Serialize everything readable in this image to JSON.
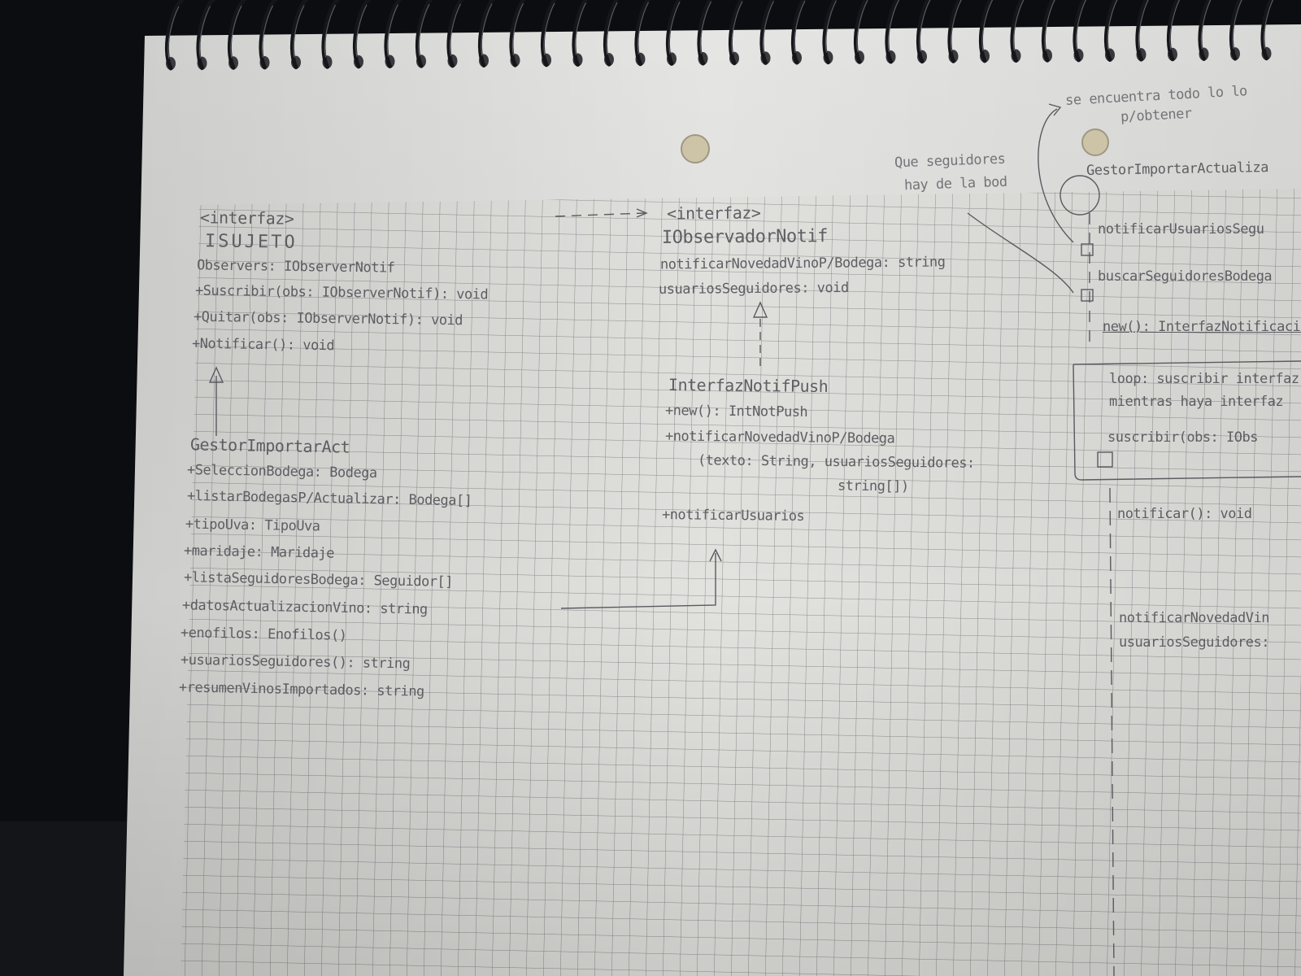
{
  "sheet": {
    "paper_color": "#e4e4e2",
    "grid_color": "#8c8c8e",
    "ink_color": "#54545a",
    "background_color": "#0c0d10"
  },
  "subject_interface": {
    "stereotype": "<interfaz>",
    "name": "ISUJETO",
    "lines": [
      "Observers: IObserverNotif",
      "+Suscribir(obs: IObserverNotif): void",
      "+Quitar(obs: IObserverNotif): void",
      "+Notificar(): void"
    ]
  },
  "gestor_class": {
    "name": "GestorImportarAct",
    "lines": [
      "+SeleccionBodega: Bodega",
      "+listarBodegasP/Actualizar: Bodega[]",
      "+tipoUva: TipoUva",
      "+maridaje: Maridaje",
      "+listaSeguidoresBodega: Seguidor[]",
      "+datosActualizacionVino: string",
      "+enofilos: Enofilos()",
      "+usuariosSeguidores(): string",
      "+resumenVinosImportados: string"
    ]
  },
  "observer_interface": {
    "stereotype": "<interfaz>",
    "name": "IObservadorNotif",
    "lines": [
      "notificarNovedadVinoP/Bodega: string",
      "usuariosSeguidores: void"
    ]
  },
  "push_class": {
    "name": "InterfazNotifPush",
    "lines": [
      "+new(): IntNotPush",
      "+notificarNovedadVinoP/Bodega",
      "(texto: String, usuariosSeguidores:",
      "string[])",
      "+notificarUsuarios"
    ]
  },
  "sequence_notes": {
    "note_top": "se encuentra todo lo lo",
    "note_top_2": "p/obtener",
    "note_left": "Que seguidores",
    "note_left_2": "hay de la bod",
    "lifeline": "GestorImportarActualiza",
    "messages": [
      "notificarUsuariosSegu",
      "buscarSeguidoresBodega",
      "new(): InterfazNotificacion",
      "loop: suscribir interfaz",
      "mientras haya interfaz",
      "suscribir(obs: IObs",
      "notificar(): void",
      "notificarNovedadVin",
      "usuariosSeguidores:"
    ]
  }
}
